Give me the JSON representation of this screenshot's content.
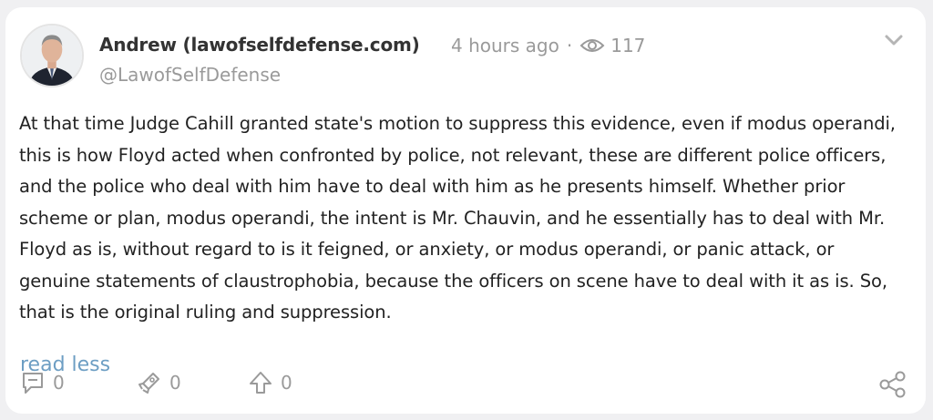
{
  "post": {
    "author_name": "Andrew (lawofselfdefense.com)",
    "time_ago": "4 hours ago",
    "separator": "·",
    "views": "117",
    "handle": "@LawofSelfDefense",
    "body": "At that time Judge Cahill granted state's motion to suppress this evidence, even if modus operandi, this is how Floyd acted when confronted by police, not relevant, these are different police officers, and the police who deal with him have to deal with him as he presents himself. Whether prior scheme or plan, modus operandi, the intent is Mr. Chauvin, and he essentially has to deal with Mr. Floyd as is, without regard to is it feigned, or anxiety, or modus operandi, or panic attack, or genuine statements of claustrophobia, because the officers on scene have to deal with it as is. So, that is the original ruling and suppression.",
    "read_less_label": "read less"
  },
  "actions": {
    "comments": "0",
    "likes": "0",
    "upvotes": "0"
  },
  "icons": {
    "views": "eye-icon",
    "menu": "chevron-down-icon",
    "comment": "comment-icon",
    "like": "rocket-icon",
    "upvote": "arrow-up-icon",
    "share": "share-icon"
  },
  "colors": {
    "background": "#f0f0f2",
    "card": "#ffffff",
    "text": "#222222",
    "muted": "#9a9a9a",
    "link": "#6d9ec3"
  }
}
